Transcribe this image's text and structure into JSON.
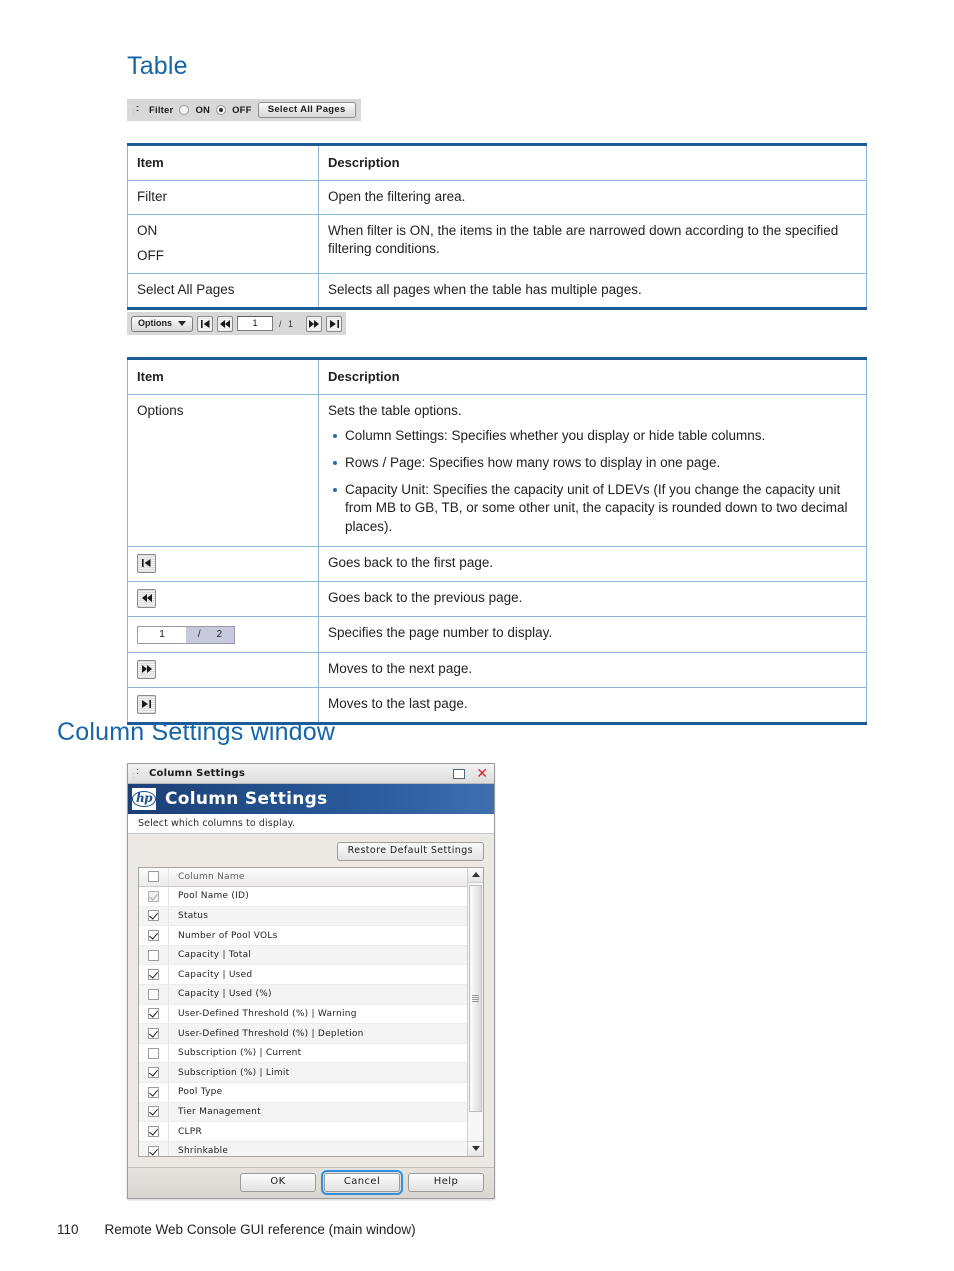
{
  "headings": {
    "table": "Table",
    "column_settings": "Column Settings window"
  },
  "filter_bar": {
    "collapse_label": "Filter",
    "radio_on_label": "ON",
    "radio_off_label": "OFF",
    "selected": "OFF",
    "select_all_pages_label": "Select All Pages"
  },
  "options_bar": {
    "options_label": "Options",
    "page_value": "1",
    "page_total": "/ 1"
  },
  "table1": {
    "headers": [
      "Item",
      "Description"
    ],
    "rows": [
      {
        "item": "Filter",
        "desc": "Open the filtering area."
      },
      {
        "item_line1": "ON",
        "item_line2": "OFF",
        "desc": "When filter is ON, the items in the table are narrowed down according to the specified filtering conditions."
      },
      {
        "item": "Select All Pages",
        "desc": "Selects all pages when the table has multiple pages."
      }
    ]
  },
  "table2": {
    "headers": [
      "Item",
      "Description"
    ],
    "options_row": {
      "item": "Options",
      "desc_intro": "Sets the table options.",
      "bullets": [
        "Column Settings: Specifies whether you display or hide table columns.",
        "Rows / Page: Specifies how many rows to display in one page.",
        "Capacity Unit: Specifies the capacity unit of LDEVs (If you change the capacity unit from MB to GB, TB, or some other unit, the capacity is rounded down to two decimal places)."
      ]
    },
    "icon_rows": [
      {
        "icon": "first-page-icon",
        "desc": "Goes back to the first page."
      },
      {
        "icon": "previous-page-icon",
        "desc": "Goes back to the previous page."
      },
      {
        "icon": "page-number-field",
        "page_value": "1",
        "page_separator": "/",
        "page_total": "2",
        "desc": "Specifies the page number to display."
      },
      {
        "icon": "next-page-icon",
        "desc": "Moves to the next page."
      },
      {
        "icon": "last-page-icon",
        "desc": "Moves to the last page."
      }
    ]
  },
  "dialog": {
    "titlebar_title": "Column Settings",
    "banner_title": "Column Settings",
    "logo_text": "hp",
    "subtitle": "Select which columns to display.",
    "restore_button": "Restore Default Settings",
    "list_header": "Column Name",
    "columns": [
      {
        "name": "Pool Name (ID)",
        "checked": true,
        "disabled": true
      },
      {
        "name": "Status",
        "checked": true,
        "disabled": false
      },
      {
        "name": "Number of Pool VOLs",
        "checked": true,
        "disabled": false
      },
      {
        "name": "Capacity | Total",
        "checked": false,
        "disabled": false
      },
      {
        "name": "Capacity | Used",
        "checked": true,
        "disabled": false
      },
      {
        "name": "Capacity | Used (%)",
        "checked": false,
        "disabled": false
      },
      {
        "name": "User-Defined Threshold (%) | Warning",
        "checked": true,
        "disabled": false
      },
      {
        "name": "User-Defined Threshold (%) | Depletion",
        "checked": true,
        "disabled": false
      },
      {
        "name": "Subscription (%) | Current",
        "checked": false,
        "disabled": false
      },
      {
        "name": "Subscription (%) | Limit",
        "checked": true,
        "disabled": false
      },
      {
        "name": "Pool Type",
        "checked": true,
        "disabled": false
      },
      {
        "name": "Tier Management",
        "checked": true,
        "disabled": false
      },
      {
        "name": "CLPR",
        "checked": true,
        "disabled": false
      },
      {
        "name": "Shrinkable",
        "checked": true,
        "disabled": false
      }
    ],
    "buttons": {
      "ok": "OK",
      "cancel": "Cancel",
      "help": "Help"
    }
  },
  "footer": {
    "page_number": "110",
    "section_title": "Remote Web Console GUI reference (main window)"
  },
  "colors": {
    "heading_blue": "#1565a8",
    "table_rule": "#1c5b96",
    "banner_blue": "#24528f"
  }
}
